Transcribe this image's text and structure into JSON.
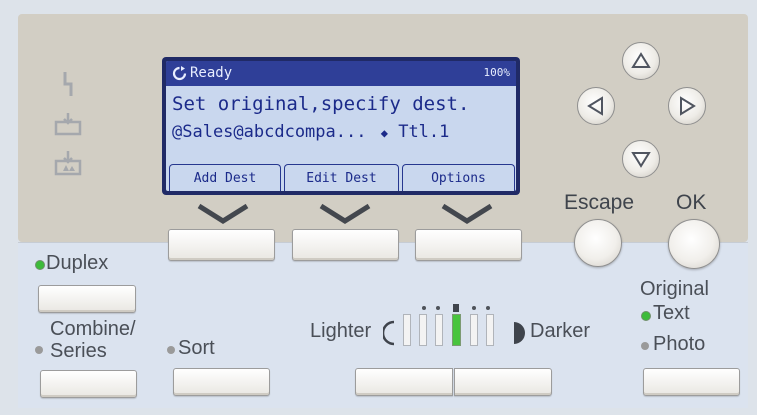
{
  "lcd": {
    "status_label": "Ready",
    "status_right": "100%",
    "line1": "Set original,specify dest.",
    "line2_dest": "@Sales@abcdcompa...",
    "line2_right": "Ttl.1",
    "softkeys": [
      "Add Dest",
      "Edit Dest",
      "Options"
    ]
  },
  "keys": {
    "escape": "Escape",
    "ok": "OK"
  },
  "left_panel": {
    "duplex": "Duplex",
    "combine": "Combine/",
    "series": "Series",
    "sort": "Sort"
  },
  "density": {
    "lighter": "Lighter",
    "darker": "Darker"
  },
  "original": {
    "title": "Original",
    "text": "Text",
    "photo": "Photo"
  },
  "colors": {
    "indicator_on": "#3dbb3a",
    "indicator_off": "#9a9a9a",
    "lcd_bg": "#c9d7ee",
    "lcd_text": "#1b2a8a"
  },
  "icons": [
    "error-indicator-icon",
    "paper-tray-icon",
    "add-toner-icon",
    "ready-status-icon",
    "scroll-updown-icon"
  ]
}
